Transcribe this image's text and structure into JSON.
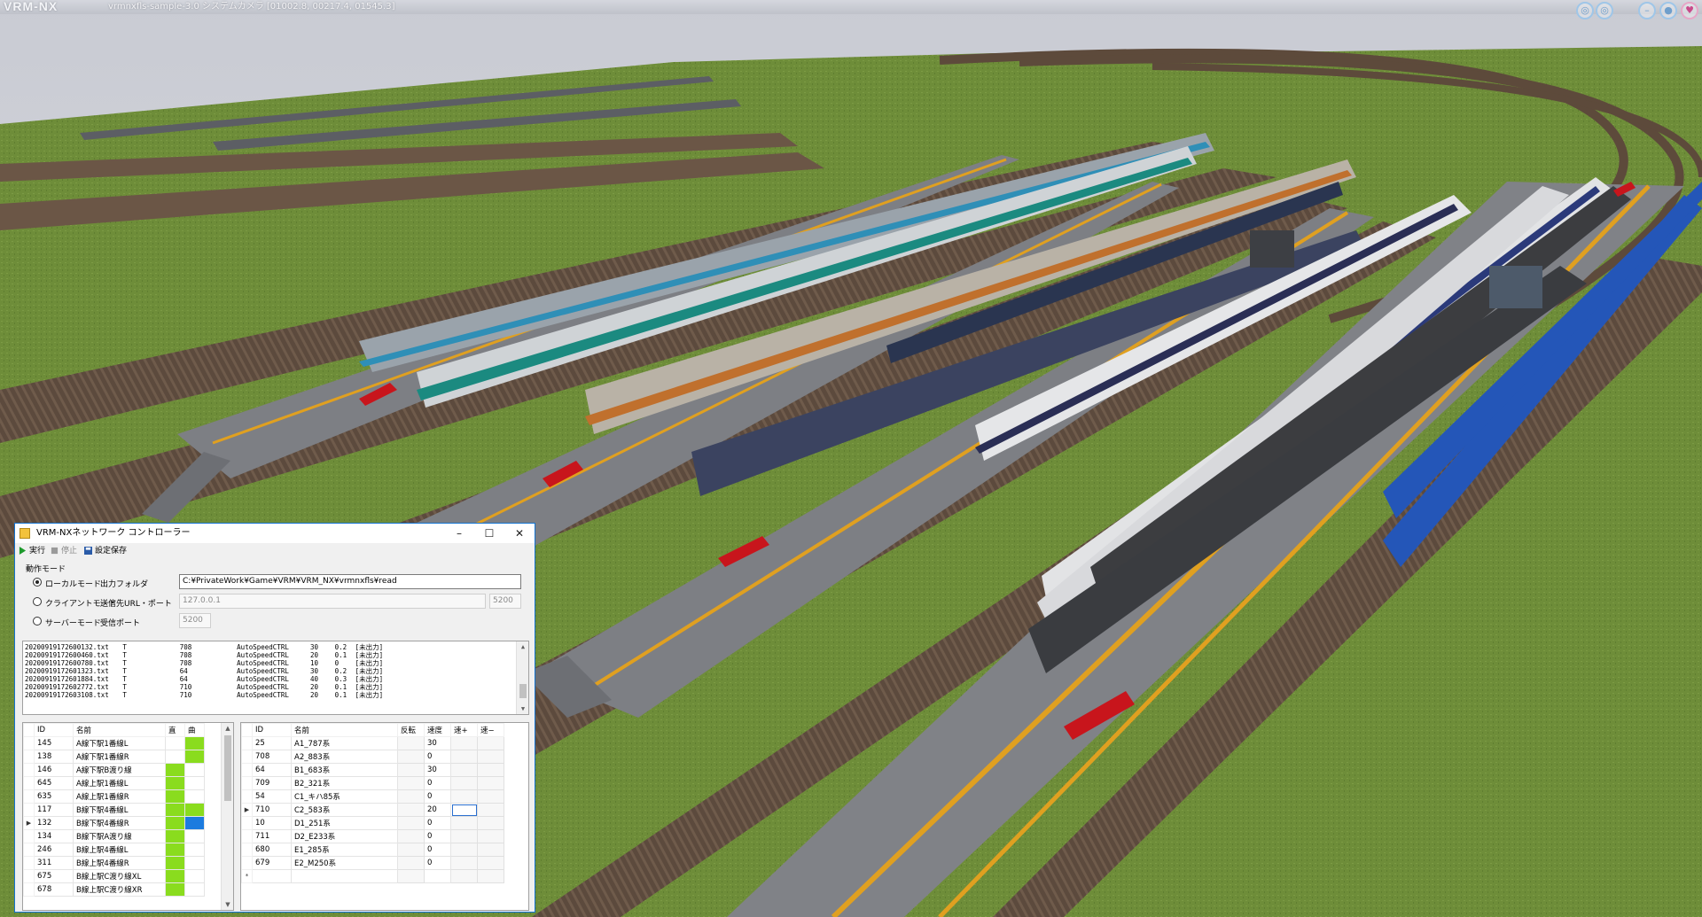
{
  "app": {
    "logo": "VRM-NX",
    "caption": "vrmnxfls-sample-3.0 システムカメラ [01002.8, 00217.4, 01545.3]"
  },
  "hud_buttons": [
    "camera-icon",
    "view-icon",
    "minimize-icon",
    "settings-icon",
    "heart-icon"
  ],
  "window": {
    "title": "VRM-NXネットワーク コントローラー",
    "controls": {
      "minimize": "–",
      "maximize": "☐",
      "close": "✕"
    },
    "toolbar": {
      "run": "実行",
      "stop": "停止",
      "save": "設定保存"
    },
    "mode_group": "動作モード",
    "local": {
      "label": "ローカルモード",
      "field_label": "出力フォルダ",
      "value": "C:¥PrivateWork¥Game¥VRM¥VRM_NX¥vrmnxfls¥read",
      "selected": true
    },
    "client": {
      "label": "クライアントモード",
      "field_label": "送信先URL・ポート",
      "url": "127.0.0.1",
      "port": "5200",
      "selected": false
    },
    "server": {
      "label": "サーバーモード",
      "field_label": "受信ポート",
      "port": "5200",
      "selected": false
    },
    "log": [
      {
        "file": "20200919172600132.txt",
        "type": "T",
        "id": "708",
        "cmd": "AutoSpeedCTRL",
        "speed": "30",
        "val": "0.2",
        "status": "[未出力]"
      },
      {
        "file": "20200919172600460.txt",
        "type": "T",
        "id": "708",
        "cmd": "AutoSpeedCTRL",
        "speed": "20",
        "val": "0.1",
        "status": "[未出力]"
      },
      {
        "file": "20200919172600780.txt",
        "type": "T",
        "id": "708",
        "cmd": "AutoSpeedCTRL",
        "speed": "10",
        "val": "0",
        "status": "[未出力]"
      },
      {
        "file": "20200919172601323.txt",
        "type": "T",
        "id": "64",
        "cmd": "AutoSpeedCTRL",
        "speed": "30",
        "val": "0.2",
        "status": "[未出力]"
      },
      {
        "file": "20200919172601884.txt",
        "type": "T",
        "id": "64",
        "cmd": "AutoSpeedCTRL",
        "speed": "40",
        "val": "0.3",
        "status": "[未出力]"
      },
      {
        "file": "20200919172602772.txt",
        "type": "T",
        "id": "710",
        "cmd": "AutoSpeedCTRL",
        "speed": "20",
        "val": "0.1",
        "status": "[未出力]"
      },
      {
        "file": "20200919172603108.txt",
        "type": "T",
        "id": "710",
        "cmd": "AutoSpeedCTRL",
        "speed": "20",
        "val": "0.1",
        "status": "[未出力]"
      }
    ],
    "points_table": {
      "headers": [
        "ID",
        "名前",
        "直",
        "曲"
      ],
      "rows": [
        {
          "id": "145",
          "name": "A線下駅1番線L",
          "s": "",
          "c": "g",
          "current": false
        },
        {
          "id": "138",
          "name": "A線下駅1番線R",
          "s": "",
          "c": "g",
          "current": false
        },
        {
          "id": "146",
          "name": "A線下駅B渡り線",
          "s": "g",
          "c": "",
          "current": false
        },
        {
          "id": "645",
          "name": "A線上駅1番線L",
          "s": "g",
          "c": "",
          "current": false
        },
        {
          "id": "635",
          "name": "A線上駅1番線R",
          "s": "g",
          "c": "",
          "current": false
        },
        {
          "id": "117",
          "name": "B線下駅4番線L",
          "s": "g",
          "c": "g",
          "current": false
        },
        {
          "id": "132",
          "name": "B線下駅4番線R",
          "s": "g",
          "c": "b",
          "current": true
        },
        {
          "id": "134",
          "name": "B線下駅A渡り線",
          "s": "g",
          "c": "",
          "current": false
        },
        {
          "id": "246",
          "name": "B線上駅4番線L",
          "s": "g",
          "c": "",
          "current": false
        },
        {
          "id": "311",
          "name": "B線上駅4番線R",
          "s": "g",
          "c": "",
          "current": false
        },
        {
          "id": "675",
          "name": "B線上駅C渡り線XL",
          "s": "g",
          "c": "",
          "current": false
        },
        {
          "id": "678",
          "name": "B線上駅C渡り線XR",
          "s": "g",
          "c": "",
          "current": false
        }
      ]
    },
    "trains_table": {
      "headers": [
        "ID",
        "名前",
        "反転",
        "速度",
        "速+",
        "速−"
      ],
      "rows": [
        {
          "id": "25",
          "name": "A1_787系",
          "speed": "30",
          "current": false
        },
        {
          "id": "708",
          "name": "A2_883系",
          "speed": "0",
          "current": false
        },
        {
          "id": "64",
          "name": "B1_683系",
          "speed": "30",
          "current": false
        },
        {
          "id": "709",
          "name": "B2_321系",
          "speed": "0",
          "current": false
        },
        {
          "id": "54",
          "name": "C1_キハ85系",
          "speed": "0",
          "current": false
        },
        {
          "id": "710",
          "name": "C2_583系",
          "speed": "20",
          "current": true
        },
        {
          "id": "10",
          "name": "D1_251系",
          "speed": "0",
          "current": false
        },
        {
          "id": "711",
          "name": "D2_E233系",
          "speed": "0",
          "current": false
        },
        {
          "id": "680",
          "name": "E1_285系",
          "speed": "0",
          "current": false
        },
        {
          "id": "679",
          "name": "E2_M250系",
          "speed": "0",
          "current": false
        }
      ]
    }
  },
  "colors": {
    "grass": "#6f8f3a",
    "ballast": "#5a4a3c",
    "platform": "#7d7f84",
    "safety_line": "#e0a020",
    "window_border": "#1473d0",
    "switch_green": "#8adc1e",
    "switch_blue": "#1c7bdf"
  }
}
